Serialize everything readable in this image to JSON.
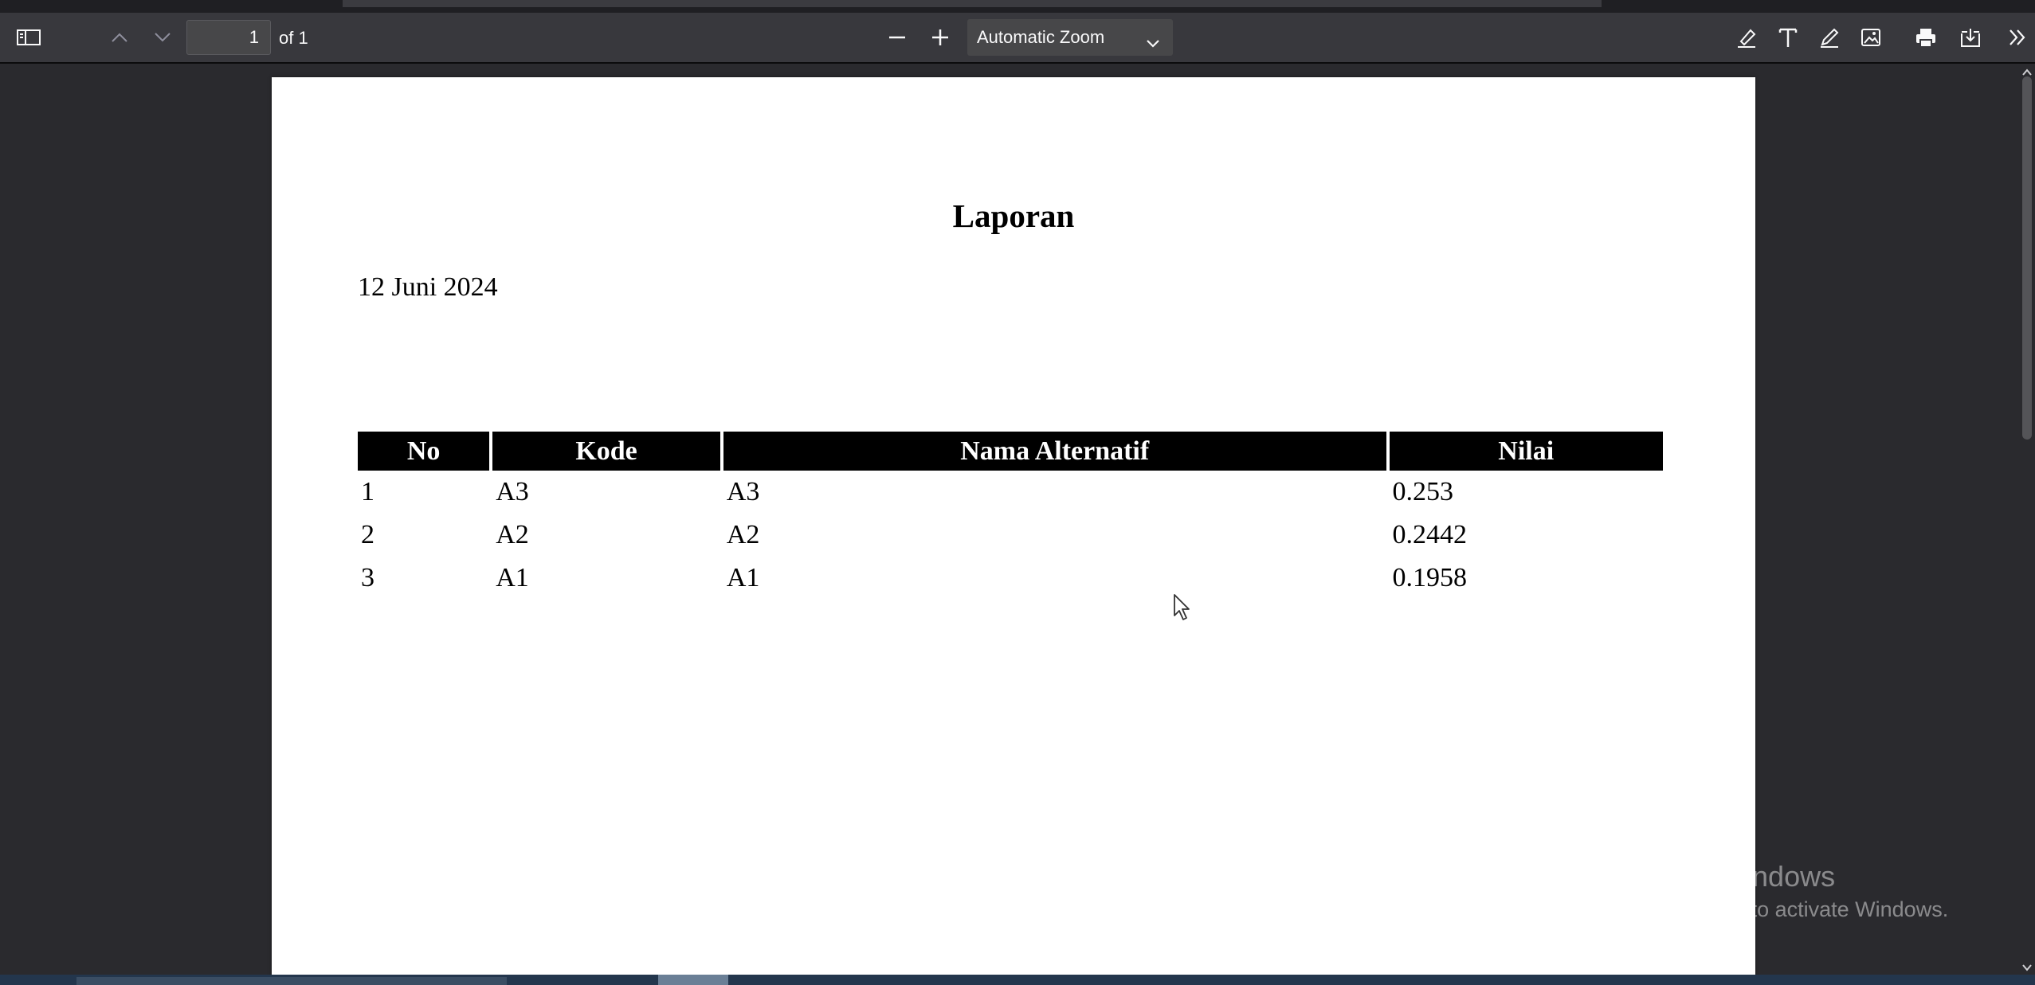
{
  "toolbar": {
    "page_number": "1",
    "page_count_label": "of 1",
    "zoom_label": "Automatic Zoom"
  },
  "document": {
    "title": "Laporan",
    "date": "12 Juni 2024",
    "table": {
      "headers": [
        "No",
        "Kode",
        "Nama Alternatif",
        "Nilai"
      ],
      "rows": [
        [
          "1",
          "A3",
          "A3",
          "0.253"
        ],
        [
          "2",
          "A2",
          "A2",
          "0.2442"
        ],
        [
          "3",
          "A1",
          "A1",
          "0.1958"
        ]
      ]
    }
  },
  "watermark": {
    "title": "Activate Windows",
    "subtitle": "Go to Settings to activate Windows."
  },
  "icons": {
    "sidebar": "sidebar-toggle-icon",
    "prev": "chevron-up-icon",
    "next": "chevron-down-icon",
    "zoom_out": "minus-icon",
    "zoom_in": "plus-icon",
    "highlight": "highlighter-icon",
    "text": "text-icon",
    "draw": "pencil-icon",
    "image": "image-icon",
    "print": "printer-icon",
    "save": "download-icon",
    "tools": "double-chevron-right-icon"
  }
}
